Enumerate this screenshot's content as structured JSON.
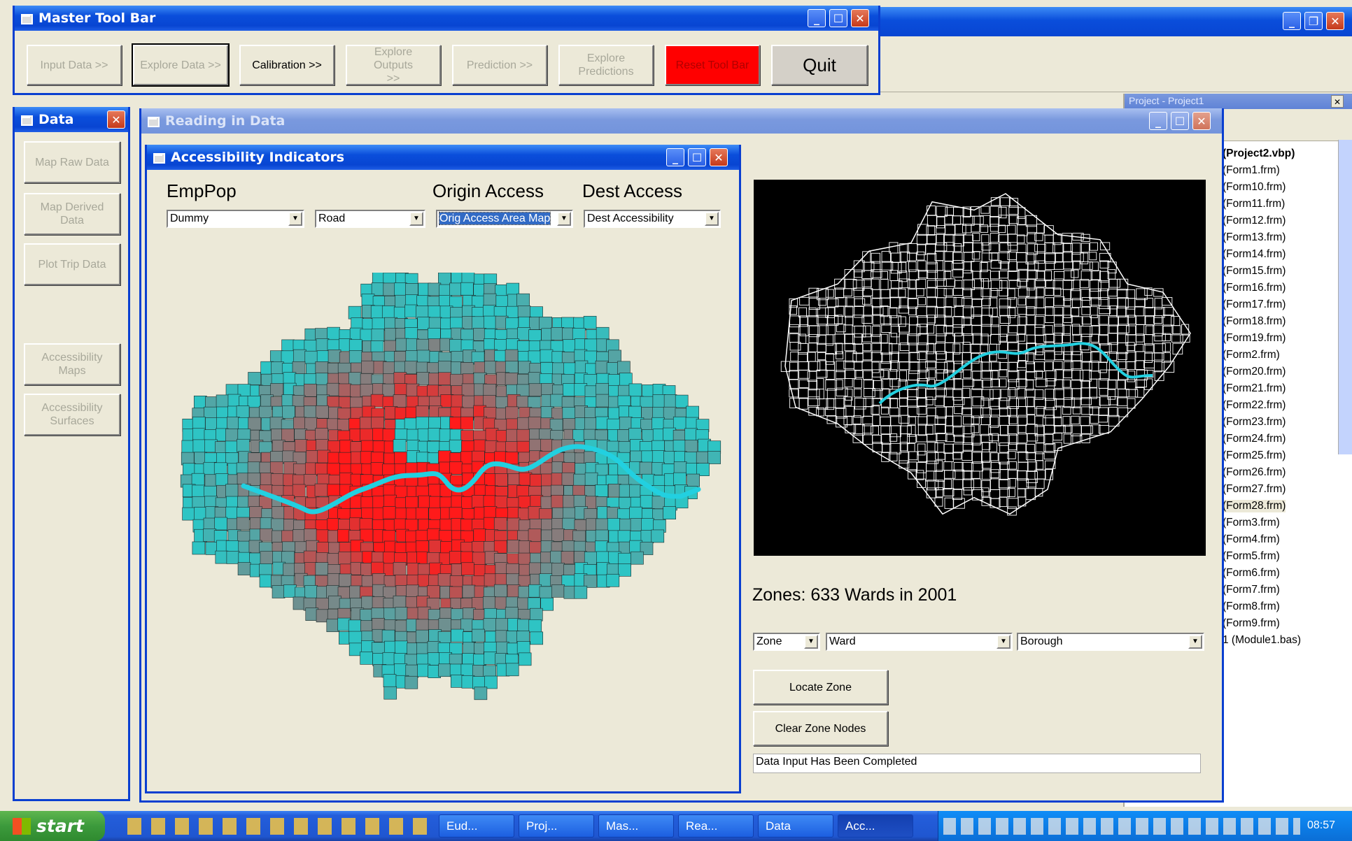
{
  "master_toolbar": {
    "title": "Master Tool Bar",
    "buttons": [
      {
        "label": "Input Data >>"
      },
      {
        "label": "Explore Data >>"
      },
      {
        "label": "Calibration >>"
      },
      {
        "label": "Explore Outputs >>"
      },
      {
        "label": "Prediction >>"
      },
      {
        "label": "Explore Predictions"
      },
      {
        "label": "Reset Tool Bar"
      },
      {
        "label": "Quit"
      }
    ]
  },
  "data_window": {
    "title": "Data",
    "buttons": [
      {
        "label": "Map Raw Data"
      },
      {
        "label": "Map Derived Data"
      },
      {
        "label": "Plot Trip Data"
      },
      {
        "label": "Accessibility Maps"
      },
      {
        "label": "Accessibility Surfaces"
      }
    ]
  },
  "reading_window": {
    "title": "Reading in Data",
    "zones_label": "Zones: 633 Wards in 2001",
    "zone_select": "Zone",
    "ward_select": "Ward",
    "borough_select": "Borough",
    "locate_button": "Locate Zone",
    "clear_button": "Clear Zone Nodes",
    "status": "Data Input Has Been Completed"
  },
  "access_window": {
    "title": "Accessibility Indicators",
    "emppop_label": "EmpPop",
    "origin_label": "Origin Access",
    "dest_label": "Dest Access",
    "emppop_value": "Dummy",
    "mode_value": "Road",
    "origin_value": "Orig Access Area Map",
    "dest_value": "Dest Accessibility"
  },
  "project_panel": {
    "title": "Project - Project1",
    "items": [
      "(Project2.vbp)",
      "(Form1.frm)",
      "(Form10.frm)",
      "(Form11.frm)",
      "(Form12.frm)",
      "(Form13.frm)",
      "(Form14.frm)",
      "(Form15.frm)",
      "(Form16.frm)",
      "(Form17.frm)",
      "(Form18.frm)",
      "(Form19.frm)",
      "(Form2.frm)",
      "(Form20.frm)",
      "(Form21.frm)",
      "(Form22.frm)",
      "(Form23.frm)",
      "(Form24.frm)",
      "(Form25.frm)",
      "(Form26.frm)",
      "(Form27.frm)",
      "(Form28.frm)",
      "(Form3.frm)",
      "(Form4.frm)",
      "(Form5.frm)",
      "(Form6.frm)",
      "(Form7.frm)",
      "(Form8.frm)",
      "(Form9.frm)",
      "1 (Module1.bas)"
    ]
  },
  "taskbar": {
    "start": "start",
    "tasks": [
      {
        "label": "Eud..."
      },
      {
        "label": "Proj..."
      },
      {
        "label": "Mas..."
      },
      {
        "label": "Rea..."
      },
      {
        "label": "Data"
      },
      {
        "label": "Acc..."
      }
    ],
    "clock": "08:57"
  },
  "colors": {
    "titlebar": "#0a4edb",
    "face": "#ece9d8",
    "reset": "#ff0000",
    "map_low": "#2ec4c4",
    "map_high": "#ff1a1a",
    "river": "#22d0e0",
    "taskbar": "#245edb",
    "start": "#3c9a3c"
  }
}
